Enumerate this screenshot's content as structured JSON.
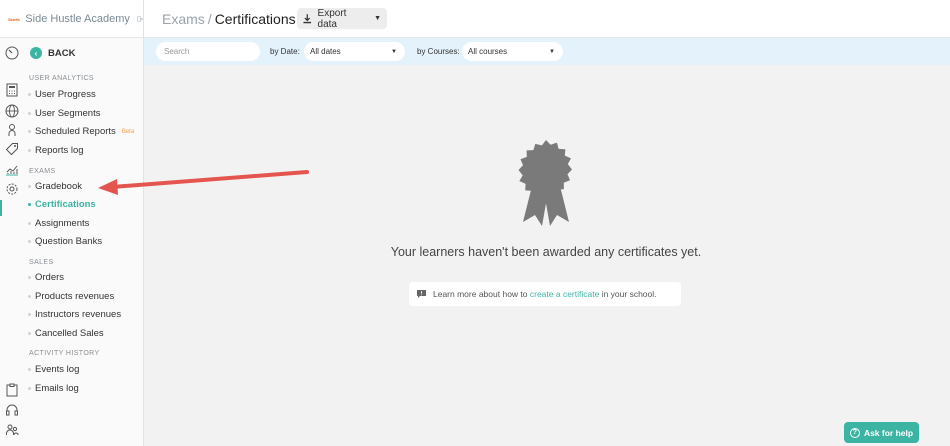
{
  "brand": {
    "logo_text": "SideHustle",
    "name": "Side Hustle Academy"
  },
  "header": {
    "breadcrumb_parent": "Exams",
    "breadcrumb_separator": "/",
    "breadcrumb_current": "Certifications",
    "export_label": "Export data"
  },
  "nav": {
    "back_label": "BACK",
    "sections": {
      "user_analytics": "USER ANALYTICS",
      "exams": "EXAMS",
      "sales": "SALES",
      "activity_history": "ACTIVITY HISTORY"
    },
    "items": {
      "user_progress": "User Progress",
      "user_segments": "User Segments",
      "scheduled_reports": "Scheduled Reports",
      "scheduled_reports_badge": "Beta",
      "reports_log": "Reports log",
      "gradebook": "Gradebook",
      "certifications": "Certifications",
      "assignments": "Assignments",
      "question_banks": "Question Banks",
      "orders": "Orders",
      "products_revenues": "Products revenues",
      "instructors_revenues": "Instructors revenues",
      "cancelled_sales": "Cancelled Sales",
      "events_log": "Events log",
      "emails_log": "Emails log"
    }
  },
  "filters": {
    "search_placeholder": "Search",
    "by_date_label": "by Date:",
    "by_date_value": "All dates",
    "by_courses_label": "by Courses:",
    "by_courses_value": "All courses"
  },
  "empty_state": {
    "message": "Your learners haven't been awarded any certificates yet.",
    "info_prefix": "Learn more about how to ",
    "info_link": "create a certificate",
    "info_suffix": " in your school."
  },
  "help": {
    "label": "Ask for help"
  },
  "colors": {
    "accent": "#3cb4a4",
    "filter_bar": "#e3f2fb",
    "annotation_arrow": "#e5554f"
  },
  "icons": [
    "logout-icon",
    "dashboard-icon",
    "calculator-icon",
    "globe-icon",
    "user-icon",
    "tag-icon",
    "analytics-icon",
    "settings-icon",
    "clipboard-icon",
    "headset-icon",
    "people-icon",
    "back-arrow-icon",
    "download-icon",
    "chevron-down-icon",
    "certificate-badge-icon",
    "info-bubble-icon",
    "question-icon"
  ]
}
